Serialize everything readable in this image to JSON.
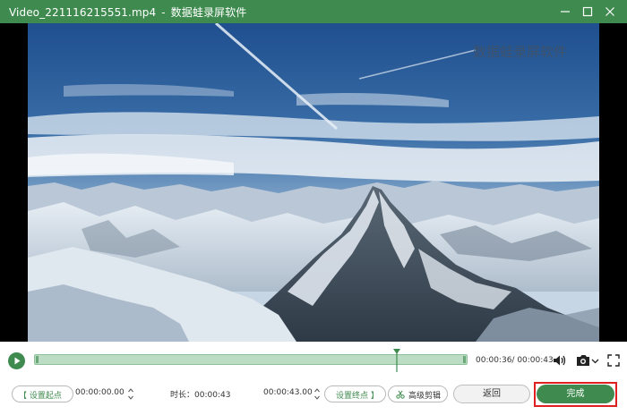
{
  "titlebar": {
    "filename": "Video_221116215551.mp4",
    "separator": "-",
    "app_name": "数据蛙录屏软件",
    "buttons": [
      "minimize",
      "maximize",
      "close"
    ],
    "bg_color": "#3f8b4f"
  },
  "video": {
    "watermark": "数据蛙录屏软件"
  },
  "player": {
    "play_icon": "play-icon",
    "current_time": "00:00:36",
    "total_time": "00:00:43",
    "time_readout": "00:00:36/ 00:00:43",
    "playhead_progress": 0.837,
    "volume_icon": "volume-icon",
    "screenshot_icon": "camera-icon",
    "fullscreen_icon": "fullscreen-icon"
  },
  "controls": {
    "set_start_label": "【 设置起点",
    "start_time": "00:00:00.00",
    "duration_label": "时长：00:00:43",
    "end_time": "00:00:43.00",
    "set_end_label": "设置终点 】",
    "advanced_label": "高级剪辑",
    "back_label": "返回",
    "done_label": "完成"
  },
  "colors": {
    "accent": "#3f8b4f",
    "timeline_fill": "#bcdcc3",
    "highlight": "#e02020"
  }
}
